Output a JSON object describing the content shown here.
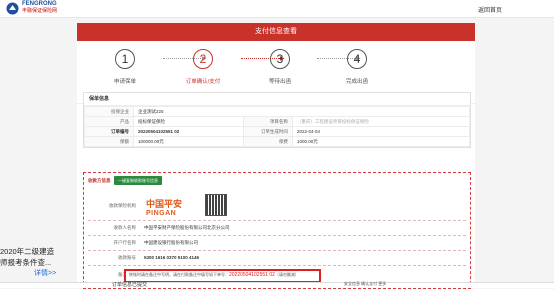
{
  "header": {
    "brand": "FENGRONG",
    "brand_sub": "丰融保证保险网",
    "home_link": "返回首页"
  },
  "panel_title": "支付信息查看",
  "steps": [
    {
      "num": "1",
      "label": "申请保单"
    },
    {
      "num": "2",
      "label": "订单确认/支付"
    },
    {
      "num": "3",
      "label": "等待出函"
    },
    {
      "num": "4",
      "label": "完成出函"
    }
  ],
  "basic": {
    "title": "保单信息",
    "insured_label": "投保企业",
    "insured_value": "企业测试225",
    "product_label": "产品",
    "product_value": "投标保证保险",
    "project_label": "项目名称",
    "project_value": "（重庆）工程建设项目投标保证保险",
    "order_label": "订单编号",
    "order_value": "20220504102551 02",
    "date_label": "订单生成时间",
    "date_value": "2022-04-04",
    "amount_label": "保额",
    "amount_value": "100000.00元",
    "premium_label": "保费",
    "premium_value": "1000.00元"
  },
  "payment": {
    "title": "收款方信息",
    "button": "一键复制收款账号信息",
    "logo_cn": "中国平安",
    "logo_en": "PINGAN",
    "row1_label": "收款保险机构",
    "row2_label": "收款人名称",
    "row2_value": "中国平安财产保险股份有限公司北京分公司",
    "row3_label": "开户行名称",
    "row3_value": "中国建设银行股份有限公司",
    "row4_label": "收款账号",
    "row4_value": "5300 1616 0370 5100 4146",
    "row5_label": "备注信息",
    "note_prefix": "转账时请在备注中写明，请在付款备注中填写如下单号：",
    "note_number": "20220504102551 02",
    "note_suffix": "（请勿删减）"
  },
  "ad": {
    "line1": "2020年二级建造",
    "line2": "师报考条件查...",
    "link": "详情>>"
  },
  "bottom": {
    "left_text": "订单信息已提交",
    "right_text": "安全信息  确认支付  更多"
  }
}
